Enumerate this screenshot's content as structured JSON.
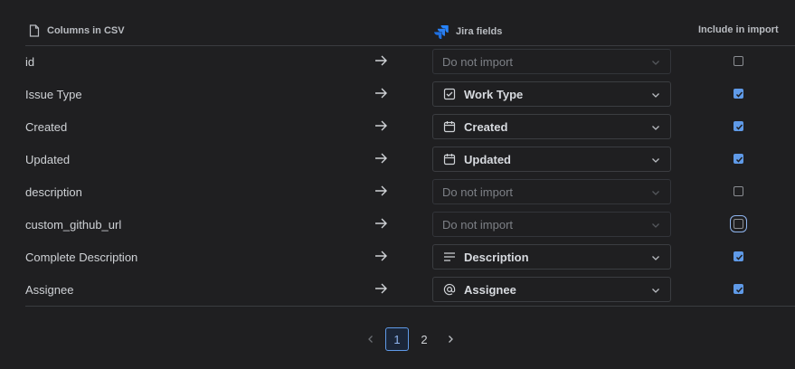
{
  "header": {
    "col_csv": "Columns in CSV",
    "col_jira": "Jira fields",
    "col_include": "Include in import"
  },
  "rows": [
    {
      "csv": "id",
      "field": "Do not import",
      "icon": "",
      "include": false
    },
    {
      "csv": "Issue Type",
      "field": "Work Type",
      "icon": "checkbox-icon",
      "include": true
    },
    {
      "csv": "Created",
      "field": "Created",
      "icon": "calendar-icon",
      "include": true
    },
    {
      "csv": "Updated",
      "field": "Updated",
      "icon": "calendar-icon",
      "include": true
    },
    {
      "csv": "description",
      "field": "Do not import",
      "icon": "",
      "include": false
    },
    {
      "csv": "custom_github_url",
      "field": "Do not import",
      "icon": "",
      "include": false
    },
    {
      "csv": "Complete Description",
      "field": "Description",
      "icon": "lines-icon",
      "include": true
    },
    {
      "csv": "Assignee",
      "field": "Assignee",
      "icon": "at-icon",
      "include": true
    }
  ],
  "pagination": {
    "pages": [
      "1",
      "2"
    ],
    "current": "1"
  },
  "colors": {
    "background": "#1f1f21",
    "accent": "#5f9ae8",
    "jira_logo": "#2684ff"
  }
}
